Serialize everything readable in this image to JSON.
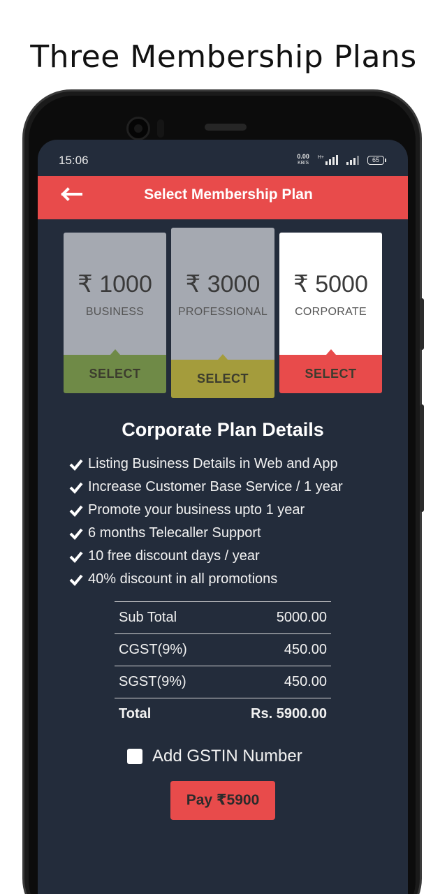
{
  "promo": {
    "title": "Three Membership Plans"
  },
  "status": {
    "time": "15:06",
    "net_speed": "0.00",
    "net_unit": "KB/S",
    "net_type": "H+",
    "battery": "65"
  },
  "appbar": {
    "title": "Select Membership Plan",
    "back_icon": "back-arrow-icon"
  },
  "plans": [
    {
      "price": "₹ 1000",
      "name": "BUSINESS",
      "select_label": "SELECT",
      "card_color": "#a5a9b1",
      "select_color": "#6f8a47",
      "selected": false
    },
    {
      "price": "₹ 3000",
      "name": "PROFESSIONAL",
      "select_label": "SELECT",
      "card_color": "#a5a9b1",
      "select_color": "#a49c3c",
      "selected": false
    },
    {
      "price": "₹ 5000",
      "name": "CORPORATE",
      "select_label": "SELECT",
      "card_color": "#ffffff",
      "select_color": "#e84b4b",
      "selected": true
    }
  ],
  "details": {
    "title": "Corporate Plan Details",
    "features": [
      "Listing Business Details in Web and App",
      "Increase Customer Base Service / 1 year",
      "Promote your business upto 1 year",
      "6 months Telecaller Support",
      "10 free discount days / year",
      "40% discount in all promotions"
    ]
  },
  "totals": {
    "rows": [
      {
        "label": "Sub Total",
        "amount": "5000.00"
      },
      {
        "label": "CGST(9%)",
        "amount": "450.00"
      },
      {
        "label": "SGST(9%)",
        "amount": "450.00"
      },
      {
        "label": "Total",
        "amount": "Rs. 5900.00"
      }
    ]
  },
  "gstin": {
    "label": "Add GSTIN Number",
    "checked": false
  },
  "pay_button": {
    "label": "Pay ₹5900"
  },
  "colors": {
    "background": "#232c3b",
    "accent": "#e84b4b"
  }
}
